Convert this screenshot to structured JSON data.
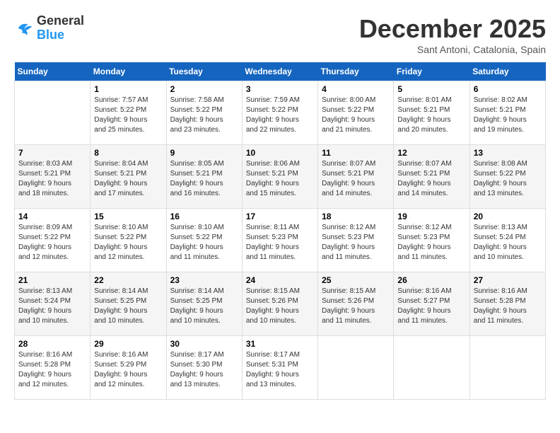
{
  "app": {
    "logo_general": "General",
    "logo_blue": "Blue"
  },
  "header": {
    "month_year": "December 2025",
    "location": "Sant Antoni, Catalonia, Spain"
  },
  "days_of_week": [
    "Sunday",
    "Monday",
    "Tuesday",
    "Wednesday",
    "Thursday",
    "Friday",
    "Saturday"
  ],
  "weeks": [
    [
      {
        "day": "",
        "info": ""
      },
      {
        "day": "1",
        "info": "Sunrise: 7:57 AM\nSunset: 5:22 PM\nDaylight: 9 hours\nand 25 minutes."
      },
      {
        "day": "2",
        "info": "Sunrise: 7:58 AM\nSunset: 5:22 PM\nDaylight: 9 hours\nand 23 minutes."
      },
      {
        "day": "3",
        "info": "Sunrise: 7:59 AM\nSunset: 5:22 PM\nDaylight: 9 hours\nand 22 minutes."
      },
      {
        "day": "4",
        "info": "Sunrise: 8:00 AM\nSunset: 5:22 PM\nDaylight: 9 hours\nand 21 minutes."
      },
      {
        "day": "5",
        "info": "Sunrise: 8:01 AM\nSunset: 5:21 PM\nDaylight: 9 hours\nand 20 minutes."
      },
      {
        "day": "6",
        "info": "Sunrise: 8:02 AM\nSunset: 5:21 PM\nDaylight: 9 hours\nand 19 minutes."
      }
    ],
    [
      {
        "day": "7",
        "info": "Sunrise: 8:03 AM\nSunset: 5:21 PM\nDaylight: 9 hours\nand 18 minutes."
      },
      {
        "day": "8",
        "info": "Sunrise: 8:04 AM\nSunset: 5:21 PM\nDaylight: 9 hours\nand 17 minutes."
      },
      {
        "day": "9",
        "info": "Sunrise: 8:05 AM\nSunset: 5:21 PM\nDaylight: 9 hours\nand 16 minutes."
      },
      {
        "day": "10",
        "info": "Sunrise: 8:06 AM\nSunset: 5:21 PM\nDaylight: 9 hours\nand 15 minutes."
      },
      {
        "day": "11",
        "info": "Sunrise: 8:07 AM\nSunset: 5:21 PM\nDaylight: 9 hours\nand 14 minutes."
      },
      {
        "day": "12",
        "info": "Sunrise: 8:07 AM\nSunset: 5:21 PM\nDaylight: 9 hours\nand 14 minutes."
      },
      {
        "day": "13",
        "info": "Sunrise: 8:08 AM\nSunset: 5:22 PM\nDaylight: 9 hours\nand 13 minutes."
      }
    ],
    [
      {
        "day": "14",
        "info": "Sunrise: 8:09 AM\nSunset: 5:22 PM\nDaylight: 9 hours\nand 12 minutes."
      },
      {
        "day": "15",
        "info": "Sunrise: 8:10 AM\nSunset: 5:22 PM\nDaylight: 9 hours\nand 12 minutes."
      },
      {
        "day": "16",
        "info": "Sunrise: 8:10 AM\nSunset: 5:22 PM\nDaylight: 9 hours\nand 11 minutes."
      },
      {
        "day": "17",
        "info": "Sunrise: 8:11 AM\nSunset: 5:23 PM\nDaylight: 9 hours\nand 11 minutes."
      },
      {
        "day": "18",
        "info": "Sunrise: 8:12 AM\nSunset: 5:23 PM\nDaylight: 9 hours\nand 11 minutes."
      },
      {
        "day": "19",
        "info": "Sunrise: 8:12 AM\nSunset: 5:23 PM\nDaylight: 9 hours\nand 11 minutes."
      },
      {
        "day": "20",
        "info": "Sunrise: 8:13 AM\nSunset: 5:24 PM\nDaylight: 9 hours\nand 10 minutes."
      }
    ],
    [
      {
        "day": "21",
        "info": "Sunrise: 8:13 AM\nSunset: 5:24 PM\nDaylight: 9 hours\nand 10 minutes."
      },
      {
        "day": "22",
        "info": "Sunrise: 8:14 AM\nSunset: 5:25 PM\nDaylight: 9 hours\nand 10 minutes."
      },
      {
        "day": "23",
        "info": "Sunrise: 8:14 AM\nSunset: 5:25 PM\nDaylight: 9 hours\nand 10 minutes."
      },
      {
        "day": "24",
        "info": "Sunrise: 8:15 AM\nSunset: 5:26 PM\nDaylight: 9 hours\nand 10 minutes."
      },
      {
        "day": "25",
        "info": "Sunrise: 8:15 AM\nSunset: 5:26 PM\nDaylight: 9 hours\nand 11 minutes."
      },
      {
        "day": "26",
        "info": "Sunrise: 8:16 AM\nSunset: 5:27 PM\nDaylight: 9 hours\nand 11 minutes."
      },
      {
        "day": "27",
        "info": "Sunrise: 8:16 AM\nSunset: 5:28 PM\nDaylight: 9 hours\nand 11 minutes."
      }
    ],
    [
      {
        "day": "28",
        "info": "Sunrise: 8:16 AM\nSunset: 5:28 PM\nDaylight: 9 hours\nand 12 minutes."
      },
      {
        "day": "29",
        "info": "Sunrise: 8:16 AM\nSunset: 5:29 PM\nDaylight: 9 hours\nand 12 minutes."
      },
      {
        "day": "30",
        "info": "Sunrise: 8:17 AM\nSunset: 5:30 PM\nDaylight: 9 hours\nand 13 minutes."
      },
      {
        "day": "31",
        "info": "Sunrise: 8:17 AM\nSunset: 5:31 PM\nDaylight: 9 hours\nand 13 minutes."
      },
      {
        "day": "",
        "info": ""
      },
      {
        "day": "",
        "info": ""
      },
      {
        "day": "",
        "info": ""
      }
    ]
  ]
}
